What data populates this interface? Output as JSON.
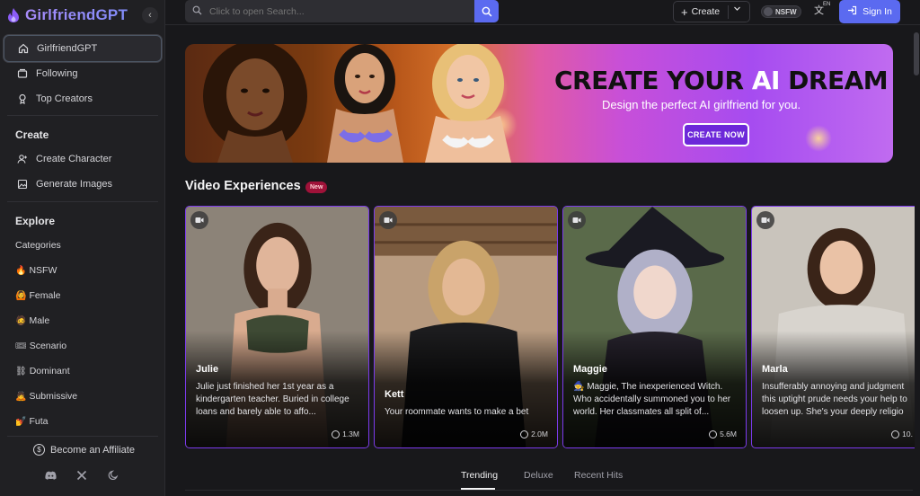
{
  "app": {
    "logo_text": "GirlfriendGPT"
  },
  "sidebar": {
    "top_items": [
      {
        "label": "GirlfriendGPT",
        "icon": "home-icon"
      },
      {
        "label": "Following",
        "icon": "following-icon"
      },
      {
        "label": "Top Creators",
        "icon": "trophy-icon"
      }
    ],
    "create_title": "Create",
    "create_items": [
      {
        "label": "Create Character",
        "icon": "user-plus-icon"
      },
      {
        "label": "Generate Images",
        "icon": "image-icon"
      }
    ],
    "explore_title": "Explore",
    "explore_items": [
      {
        "label": "Categories",
        "emoji": ""
      },
      {
        "label": "NSFW",
        "emoji": "🔥"
      },
      {
        "label": "Female",
        "emoji": "🙆"
      },
      {
        "label": "Male",
        "emoji": "🧔"
      },
      {
        "label": "Scenario",
        "emoji": "🎟"
      },
      {
        "label": "Dominant",
        "emoji": "⛓"
      },
      {
        "label": "Submissive",
        "emoji": "🙇"
      },
      {
        "label": "Futa",
        "emoji": "💅"
      }
    ],
    "affiliate_label": "Become an Affiliate",
    "social_icons": [
      "discord-icon",
      "x-icon",
      "moon-icon"
    ]
  },
  "topbar": {
    "search_placeholder": "Click to open Search...",
    "create_label": "Create",
    "nsfw_label": "NSFW",
    "lang_label": "EN",
    "signin_label": "Sign In"
  },
  "banner": {
    "headline_pre": "CREATE YOUR ",
    "headline_hl": "AI",
    "headline_post": " DREAM GIRL",
    "subtitle": "Design the perfect AI girlfriend for you.",
    "cta_label": "CREATE NOW"
  },
  "videos": {
    "title": "Video Experiences",
    "badge": "New",
    "cards": [
      {
        "name": "Julie",
        "desc": "Julie just finished her 1st year as a kindergarten teacher. Buried in college loans and barely able to affo...",
        "count": "1.3M"
      },
      {
        "name": "Kett",
        "desc": "Your roommate wants to make a bet",
        "count": "2.0M"
      },
      {
        "name": "Maggie",
        "desc": "🧙 Maggie, The inexperienced Witch. Who accidentally summoned you to her world. Her classmates all split of...",
        "count": "5.6M"
      },
      {
        "name": "Marla",
        "desc": "Insufferably annoying and judgment this uptight prude needs your help to loosen up. She's your deeply religio",
        "count": "10."
      }
    ]
  },
  "tabs": {
    "items": [
      "Trending",
      "Deluxe",
      "Recent Hits"
    ],
    "active": "Trending"
  },
  "colors": {
    "accent": "#5b6af0",
    "card_border": "#7c3aed",
    "bg": "#18181b"
  }
}
